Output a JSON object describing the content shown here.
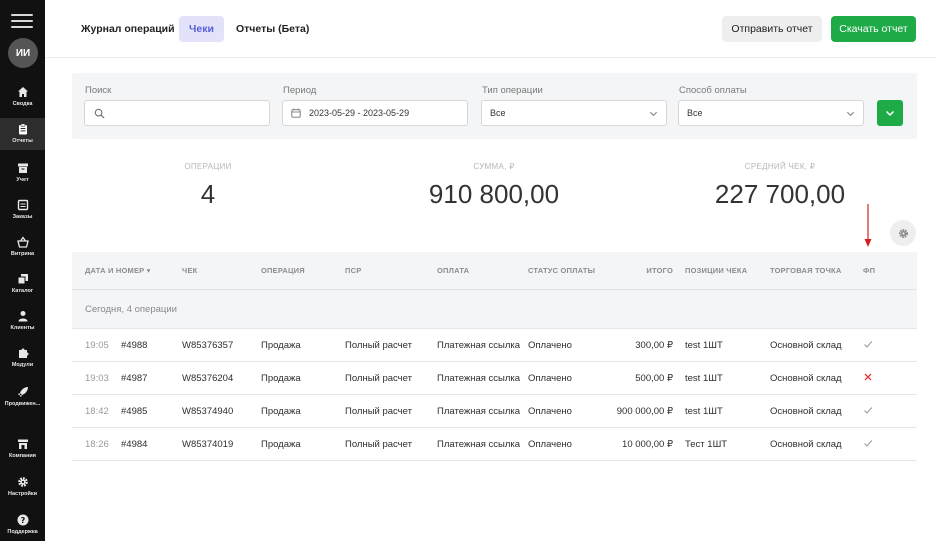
{
  "sidebar": {
    "avatar": "ИИ",
    "items": [
      {
        "label": "Сводка",
        "icon": "home-icon"
      },
      {
        "label": "Отчеты",
        "icon": "clipboard-icon",
        "active": true
      },
      {
        "label": "Учет",
        "icon": "box-icon"
      },
      {
        "label": "Заказы",
        "icon": "orders-icon"
      },
      {
        "label": "Витрина",
        "icon": "basket-icon"
      },
      {
        "label": "Каталог",
        "icon": "catalog-icon"
      },
      {
        "label": "Клиенты",
        "icon": "user-icon"
      },
      {
        "label": "Модули",
        "icon": "puzzle-icon"
      },
      {
        "label": "Продвижен...",
        "icon": "rocket-icon"
      },
      {
        "label": "Компания",
        "icon": "shop-icon"
      },
      {
        "label": "Настройки",
        "icon": "gear-icon"
      },
      {
        "label": "Поддержка",
        "icon": "help-icon"
      }
    ]
  },
  "header": {
    "tabs": [
      {
        "label": "Журнал операций"
      },
      {
        "label": "Чеки",
        "active": true
      },
      {
        "label": "Отчеты (Бета)"
      }
    ],
    "send_label": "Отправить отчет",
    "download_label": "Скачать отчет"
  },
  "filters": {
    "search_label": "Поиск",
    "search_placeholder": "",
    "period_label": "Период",
    "period_value": "2023-05-29 - 2023-05-29",
    "op_type_label": "Тип операции",
    "op_type_value": "Все",
    "payment_label": "Способ оплаты",
    "payment_value": "Все"
  },
  "stats": {
    "operations_label": "ОПЕРАЦИИ",
    "operations_value": "4",
    "sum_label": "СУММА, ₽",
    "sum_value": "910 800,00",
    "avg_label": "СРЕДНИЙ ЧЕК, ₽",
    "avg_value": "227 700,00"
  },
  "table": {
    "columns": [
      "ДАТА И НОМЕР ▾",
      "ЧЕК",
      "ОПЕРАЦИЯ",
      "ПСР",
      "ОПЛАТА",
      "СТАТУС ОПЛАТЫ",
      "ИТОГО",
      "ПОЗИЦИИ ЧЕКА",
      "ТОРГОВАЯ ТОЧКА",
      "ФП"
    ],
    "group_label": "Сегодня, 4 операции",
    "rows": [
      {
        "time": "19:05",
        "number": "#4988",
        "check": "W85376357",
        "operation": "Продажа",
        "psr": "Полный расчет",
        "payment": "Платежная ссылка",
        "status": "Оплачено",
        "total": "300,00 ₽",
        "positions": "test 1ШТ",
        "point": "Основной склад",
        "fp": "ok"
      },
      {
        "time": "19:03",
        "number": "#4987",
        "check": "W85376204",
        "operation": "Продажа",
        "psr": "Полный расчет",
        "payment": "Платежная ссылка",
        "status": "Оплачено",
        "total": "500,00 ₽",
        "positions": "test 1ШТ",
        "point": "Основной склад",
        "fp": "error"
      },
      {
        "time": "18:42",
        "number": "#4985",
        "check": "W85374940",
        "operation": "Продажа",
        "psr": "Полный расчет",
        "payment": "Платежная ссылка",
        "status": "Оплачено",
        "total": "900 000,00 ₽",
        "positions": "test 1ШТ",
        "point": "Основной склад",
        "fp": "ok"
      },
      {
        "time": "18:26",
        "number": "#4984",
        "check": "W85374019",
        "operation": "Продажа",
        "psr": "Полный расчет",
        "payment": "Платежная ссылка",
        "status": "Оплачено",
        "total": "10 000,00 ₽",
        "positions": "Тест 1ШТ",
        "point": "Основной склад",
        "fp": "ok"
      }
    ]
  },
  "colors": {
    "accent_green": "#1faa48",
    "tab_active_bg": "#e2e3fb",
    "tab_active_text": "#5a5fd6",
    "error_red": "#e53935",
    "sidebar_bg": "#111111"
  }
}
